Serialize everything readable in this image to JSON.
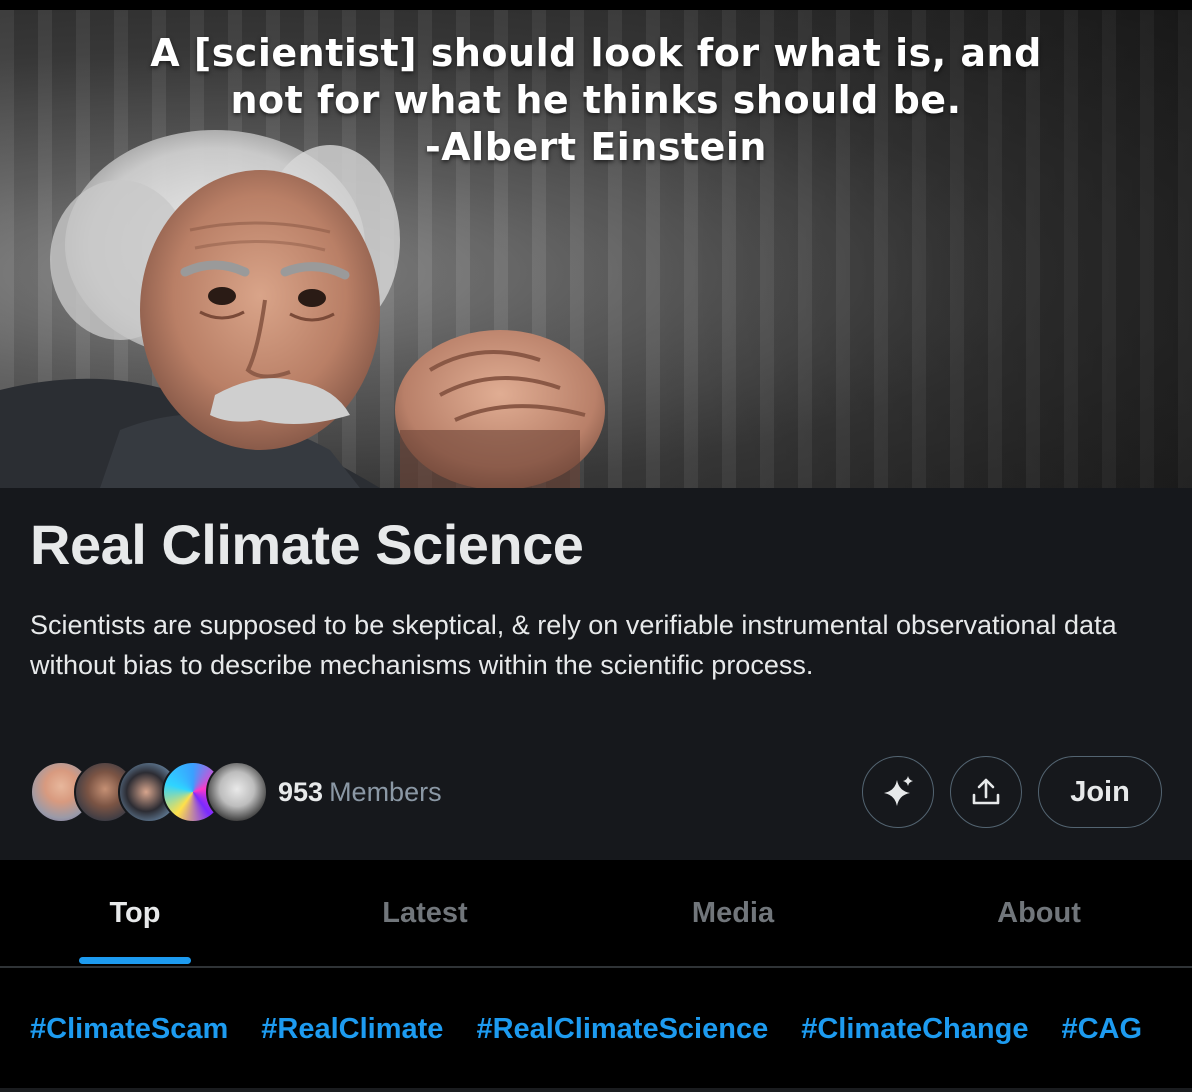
{
  "banner": {
    "quote_lines": [
      "A [scientist] should look for what is, and",
      "not for what he thinks should be.",
      "-Albert Einstein"
    ]
  },
  "community": {
    "name": "Real Climate Science",
    "description": "Scientists are supposed to be skeptical, & rely on verifiable instrumental observational data without bias to describe mechanisms within the scientific process.",
    "member_count": "953",
    "member_label": "Members"
  },
  "actions": {
    "grok_icon": "sparkle-icon",
    "share_icon": "share-icon",
    "join_label": "Join"
  },
  "tabs": [
    {
      "label": "Top",
      "active": true
    },
    {
      "label": "Latest",
      "active": false
    },
    {
      "label": "Media",
      "active": false
    },
    {
      "label": "About",
      "active": false
    }
  ],
  "hashtags": [
    "#ClimateScam",
    "#RealClimate",
    "#RealClimateScience",
    "#ClimateChange",
    "#CAG"
  ],
  "colors": {
    "accent": "#1d9bf0",
    "panel": "#16181c",
    "text": "#e7e9ea",
    "muted": "#8b98a5"
  }
}
